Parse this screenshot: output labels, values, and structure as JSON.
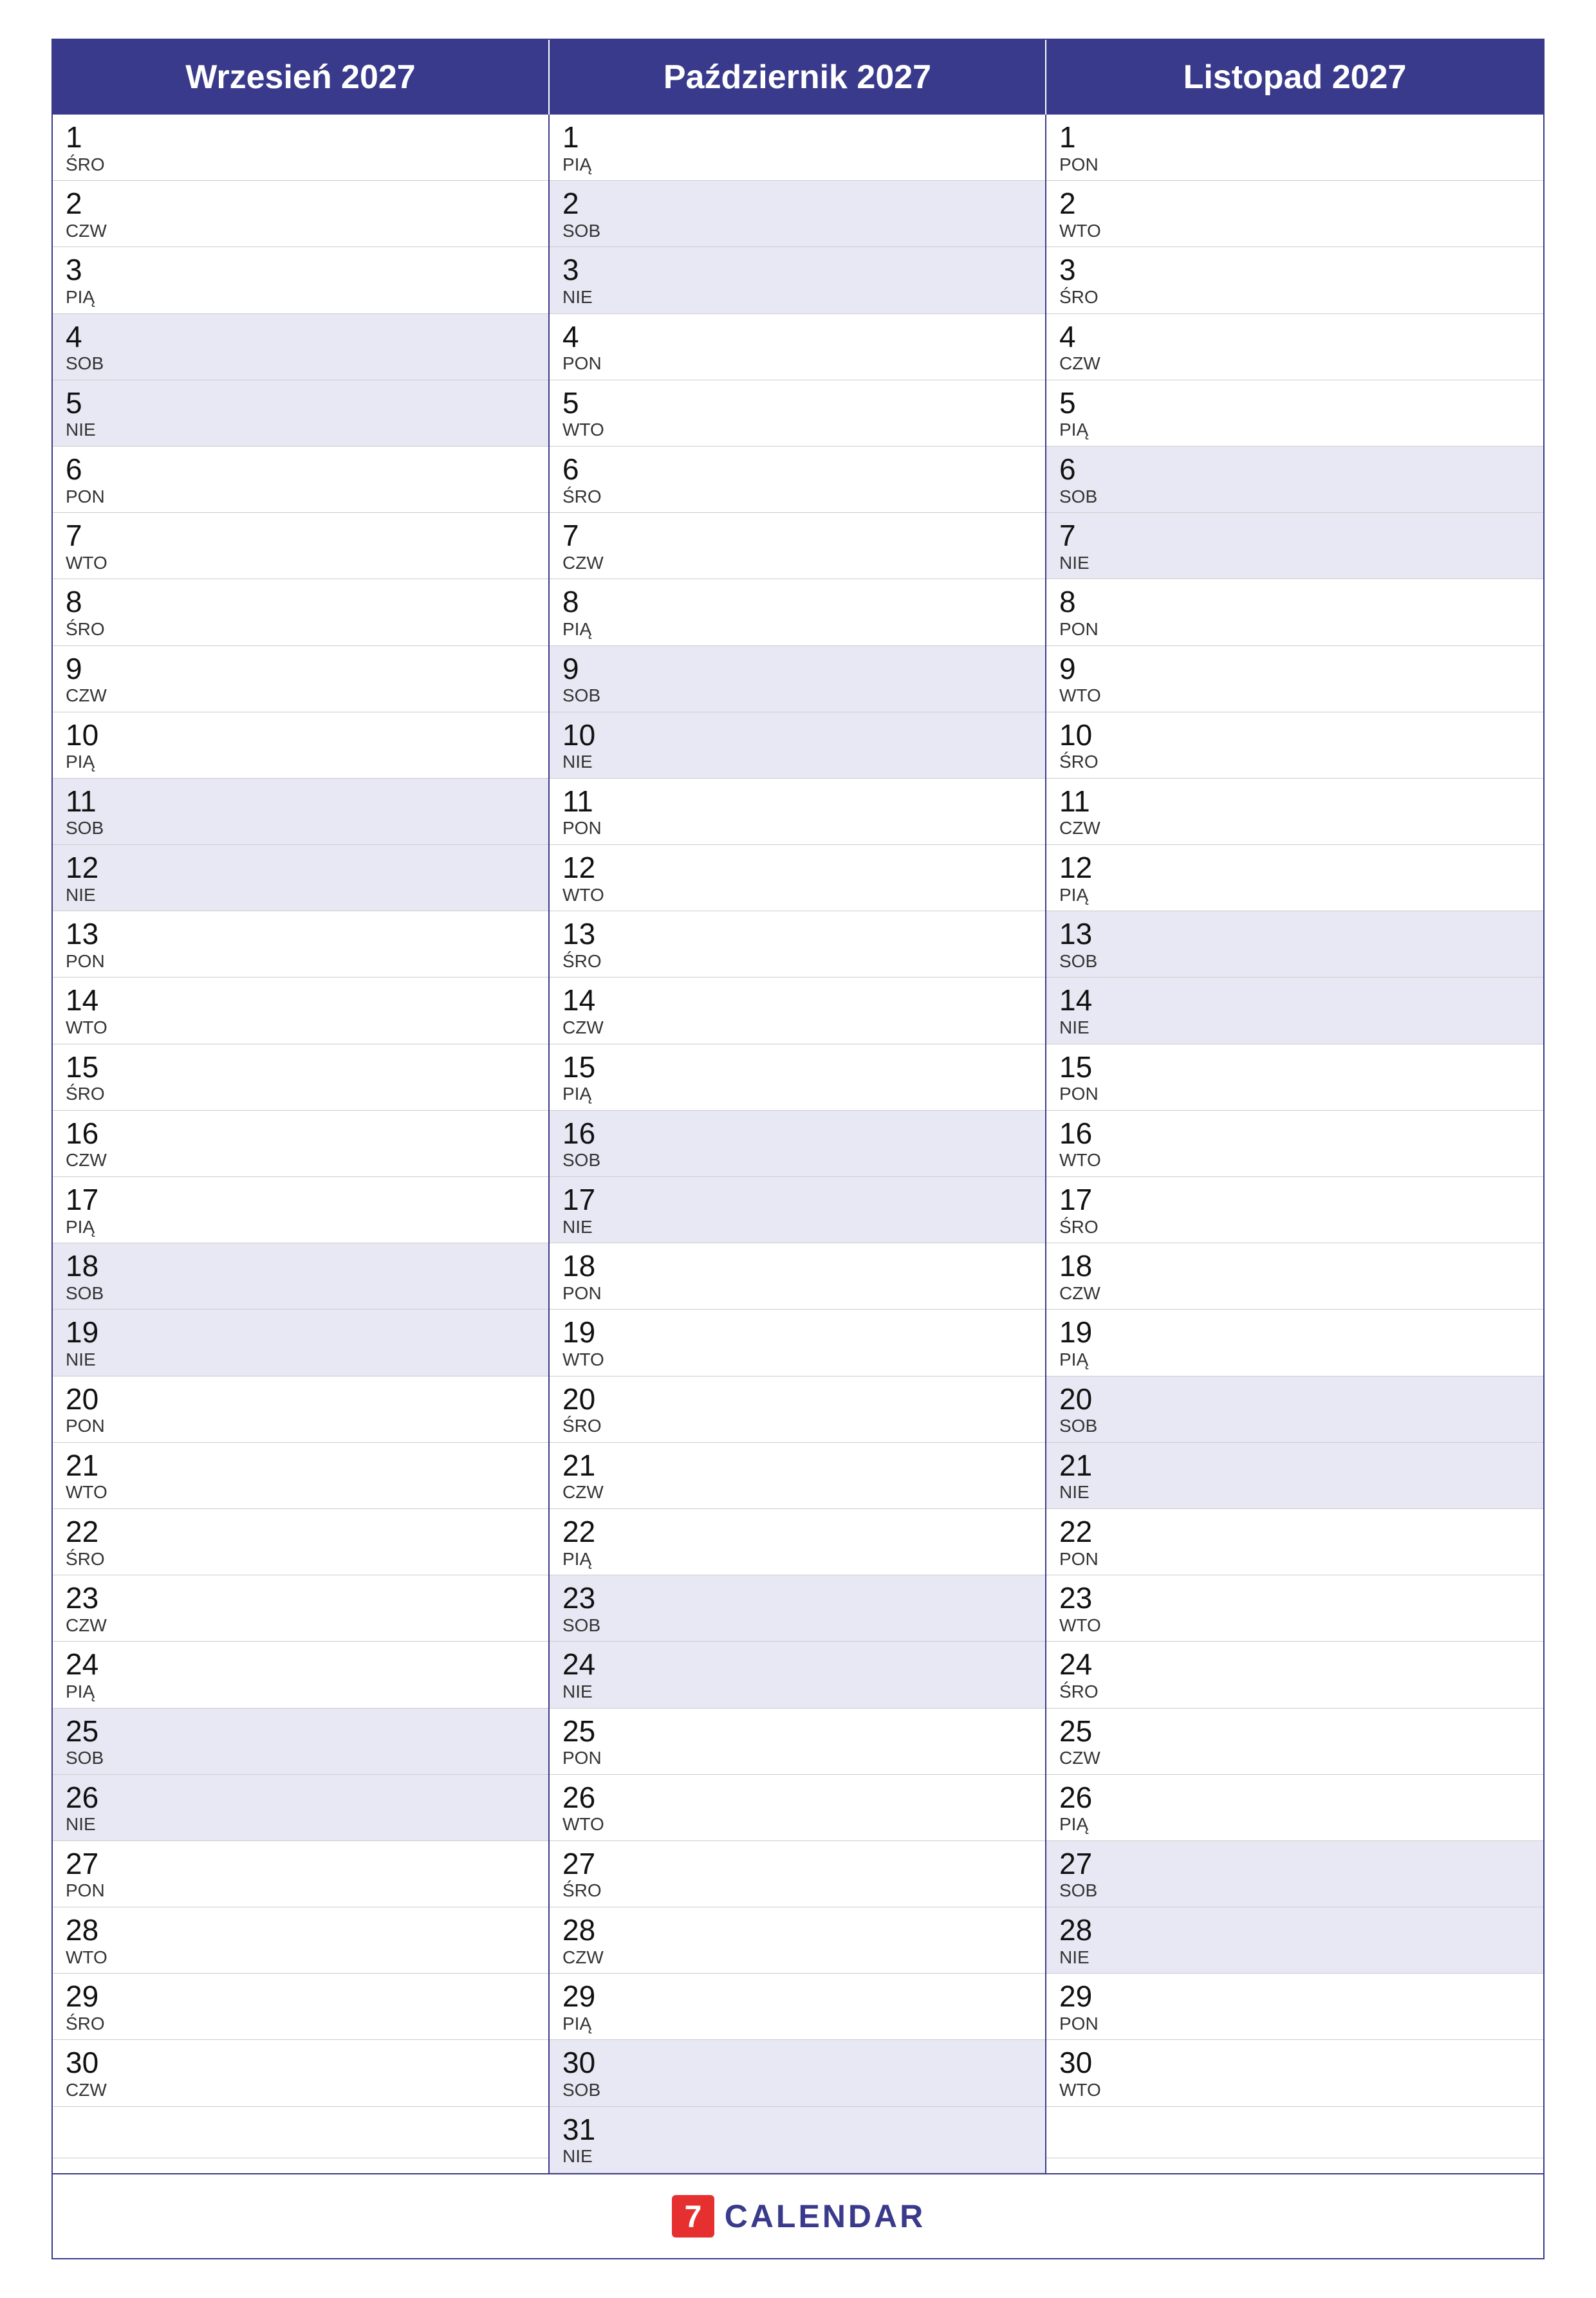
{
  "months": [
    {
      "name": "Wrzesień 2027",
      "days": [
        {
          "num": "1",
          "name": "ŚRO",
          "weekend": false
        },
        {
          "num": "2",
          "name": "CZW",
          "weekend": false
        },
        {
          "num": "3",
          "name": "PIĄ",
          "weekend": false
        },
        {
          "num": "4",
          "name": "SOB",
          "weekend": true
        },
        {
          "num": "5",
          "name": "NIE",
          "weekend": true
        },
        {
          "num": "6",
          "name": "PON",
          "weekend": false
        },
        {
          "num": "7",
          "name": "WTO",
          "weekend": false
        },
        {
          "num": "8",
          "name": "ŚRO",
          "weekend": false
        },
        {
          "num": "9",
          "name": "CZW",
          "weekend": false
        },
        {
          "num": "10",
          "name": "PIĄ",
          "weekend": false
        },
        {
          "num": "11",
          "name": "SOB",
          "weekend": true
        },
        {
          "num": "12",
          "name": "NIE",
          "weekend": true
        },
        {
          "num": "13",
          "name": "PON",
          "weekend": false
        },
        {
          "num": "14",
          "name": "WTO",
          "weekend": false
        },
        {
          "num": "15",
          "name": "ŚRO",
          "weekend": false
        },
        {
          "num": "16",
          "name": "CZW",
          "weekend": false
        },
        {
          "num": "17",
          "name": "PIĄ",
          "weekend": false
        },
        {
          "num": "18",
          "name": "SOB",
          "weekend": true
        },
        {
          "num": "19",
          "name": "NIE",
          "weekend": true
        },
        {
          "num": "20",
          "name": "PON",
          "weekend": false
        },
        {
          "num": "21",
          "name": "WTO",
          "weekend": false
        },
        {
          "num": "22",
          "name": "ŚRO",
          "weekend": false
        },
        {
          "num": "23",
          "name": "CZW",
          "weekend": false
        },
        {
          "num": "24",
          "name": "PIĄ",
          "weekend": false
        },
        {
          "num": "25",
          "name": "SOB",
          "weekend": true
        },
        {
          "num": "26",
          "name": "NIE",
          "weekend": true
        },
        {
          "num": "27",
          "name": "PON",
          "weekend": false
        },
        {
          "num": "28",
          "name": "WTO",
          "weekend": false
        },
        {
          "num": "29",
          "name": "ŚRO",
          "weekend": false
        },
        {
          "num": "30",
          "name": "CZW",
          "weekend": false
        }
      ]
    },
    {
      "name": "Październik 2027",
      "days": [
        {
          "num": "1",
          "name": "PIĄ",
          "weekend": false
        },
        {
          "num": "2",
          "name": "SOB",
          "weekend": true
        },
        {
          "num": "3",
          "name": "NIE",
          "weekend": true
        },
        {
          "num": "4",
          "name": "PON",
          "weekend": false
        },
        {
          "num": "5",
          "name": "WTO",
          "weekend": false
        },
        {
          "num": "6",
          "name": "ŚRO",
          "weekend": false
        },
        {
          "num": "7",
          "name": "CZW",
          "weekend": false
        },
        {
          "num": "8",
          "name": "PIĄ",
          "weekend": false
        },
        {
          "num": "9",
          "name": "SOB",
          "weekend": true
        },
        {
          "num": "10",
          "name": "NIE",
          "weekend": true
        },
        {
          "num": "11",
          "name": "PON",
          "weekend": false
        },
        {
          "num": "12",
          "name": "WTO",
          "weekend": false
        },
        {
          "num": "13",
          "name": "ŚRO",
          "weekend": false
        },
        {
          "num": "14",
          "name": "CZW",
          "weekend": false
        },
        {
          "num": "15",
          "name": "PIĄ",
          "weekend": false
        },
        {
          "num": "16",
          "name": "SOB",
          "weekend": true
        },
        {
          "num": "17",
          "name": "NIE",
          "weekend": true
        },
        {
          "num": "18",
          "name": "PON",
          "weekend": false
        },
        {
          "num": "19",
          "name": "WTO",
          "weekend": false
        },
        {
          "num": "20",
          "name": "ŚRO",
          "weekend": false
        },
        {
          "num": "21",
          "name": "CZW",
          "weekend": false
        },
        {
          "num": "22",
          "name": "PIĄ",
          "weekend": false
        },
        {
          "num": "23",
          "name": "SOB",
          "weekend": true
        },
        {
          "num": "24",
          "name": "NIE",
          "weekend": true
        },
        {
          "num": "25",
          "name": "PON",
          "weekend": false
        },
        {
          "num": "26",
          "name": "WTO",
          "weekend": false
        },
        {
          "num": "27",
          "name": "ŚRO",
          "weekend": false
        },
        {
          "num": "28",
          "name": "CZW",
          "weekend": false
        },
        {
          "num": "29",
          "name": "PIĄ",
          "weekend": false
        },
        {
          "num": "30",
          "name": "SOB",
          "weekend": true
        },
        {
          "num": "31",
          "name": "NIE",
          "weekend": true
        }
      ]
    },
    {
      "name": "Listopad 2027",
      "days": [
        {
          "num": "1",
          "name": "PON",
          "weekend": false
        },
        {
          "num": "2",
          "name": "WTO",
          "weekend": false
        },
        {
          "num": "3",
          "name": "ŚRO",
          "weekend": false
        },
        {
          "num": "4",
          "name": "CZW",
          "weekend": false
        },
        {
          "num": "5",
          "name": "PIĄ",
          "weekend": false
        },
        {
          "num": "6",
          "name": "SOB",
          "weekend": true
        },
        {
          "num": "7",
          "name": "NIE",
          "weekend": true
        },
        {
          "num": "8",
          "name": "PON",
          "weekend": false
        },
        {
          "num": "9",
          "name": "WTO",
          "weekend": false
        },
        {
          "num": "10",
          "name": "ŚRO",
          "weekend": false
        },
        {
          "num": "11",
          "name": "CZW",
          "weekend": false
        },
        {
          "num": "12",
          "name": "PIĄ",
          "weekend": false
        },
        {
          "num": "13",
          "name": "SOB",
          "weekend": true
        },
        {
          "num": "14",
          "name": "NIE",
          "weekend": true
        },
        {
          "num": "15",
          "name": "PON",
          "weekend": false
        },
        {
          "num": "16",
          "name": "WTO",
          "weekend": false
        },
        {
          "num": "17",
          "name": "ŚRO",
          "weekend": false
        },
        {
          "num": "18",
          "name": "CZW",
          "weekend": false
        },
        {
          "num": "19",
          "name": "PIĄ",
          "weekend": false
        },
        {
          "num": "20",
          "name": "SOB",
          "weekend": true
        },
        {
          "num": "21",
          "name": "NIE",
          "weekend": true
        },
        {
          "num": "22",
          "name": "PON",
          "weekend": false
        },
        {
          "num": "23",
          "name": "WTO",
          "weekend": false
        },
        {
          "num": "24",
          "name": "ŚRO",
          "weekend": false
        },
        {
          "num": "25",
          "name": "CZW",
          "weekend": false
        },
        {
          "num": "26",
          "name": "PIĄ",
          "weekend": false
        },
        {
          "num": "27",
          "name": "SOB",
          "weekend": true
        },
        {
          "num": "28",
          "name": "NIE",
          "weekend": true
        },
        {
          "num": "29",
          "name": "PON",
          "weekend": false
        },
        {
          "num": "30",
          "name": "WTO",
          "weekend": false
        }
      ]
    }
  ],
  "footer": {
    "logo_symbol": "7",
    "brand_name": "CALENDAR"
  }
}
